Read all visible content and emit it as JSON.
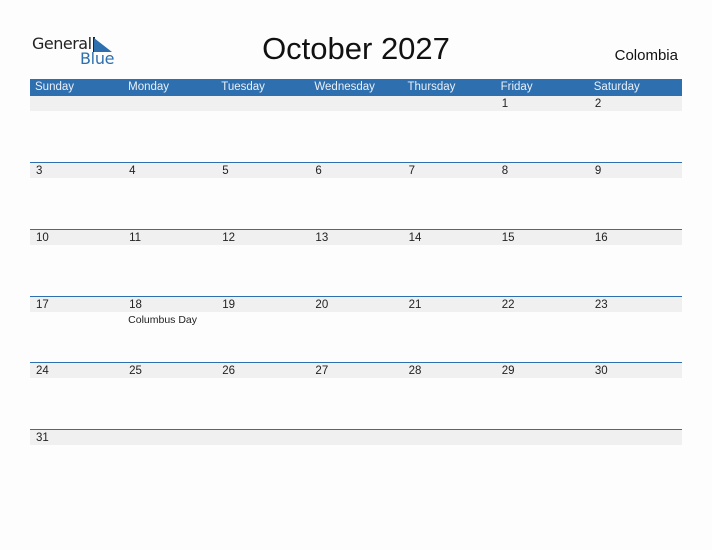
{
  "logo": {
    "line1": "General",
    "line2": "Blue"
  },
  "title": "October 2027",
  "country": "Colombia",
  "colors": {
    "accent": "#2E6FB0",
    "date_strip": "#F0F0F0"
  },
  "weekdays": [
    "Sunday",
    "Monday",
    "Tuesday",
    "Wednesday",
    "Thursday",
    "Friday",
    "Saturday"
  ],
  "weeks": [
    [
      {
        "d": ""
      },
      {
        "d": ""
      },
      {
        "d": ""
      },
      {
        "d": ""
      },
      {
        "d": ""
      },
      {
        "d": "1"
      },
      {
        "d": "2"
      }
    ],
    [
      {
        "d": "3"
      },
      {
        "d": "4"
      },
      {
        "d": "5"
      },
      {
        "d": "6"
      },
      {
        "d": "7"
      },
      {
        "d": "8"
      },
      {
        "d": "9"
      }
    ],
    [
      {
        "d": "10"
      },
      {
        "d": "11"
      },
      {
        "d": "12"
      },
      {
        "d": "13"
      },
      {
        "d": "14"
      },
      {
        "d": "15"
      },
      {
        "d": "16"
      }
    ],
    [
      {
        "d": "17"
      },
      {
        "d": "18",
        "holiday": "Columbus Day"
      },
      {
        "d": "19"
      },
      {
        "d": "20"
      },
      {
        "d": "21"
      },
      {
        "d": "22"
      },
      {
        "d": "23"
      }
    ],
    [
      {
        "d": "24"
      },
      {
        "d": "25"
      },
      {
        "d": "26"
      },
      {
        "d": "27"
      },
      {
        "d": "28"
      },
      {
        "d": "29"
      },
      {
        "d": "30"
      }
    ],
    [
      {
        "d": "31"
      },
      {
        "d": ""
      },
      {
        "d": ""
      },
      {
        "d": ""
      },
      {
        "d": ""
      },
      {
        "d": ""
      },
      {
        "d": ""
      }
    ]
  ]
}
